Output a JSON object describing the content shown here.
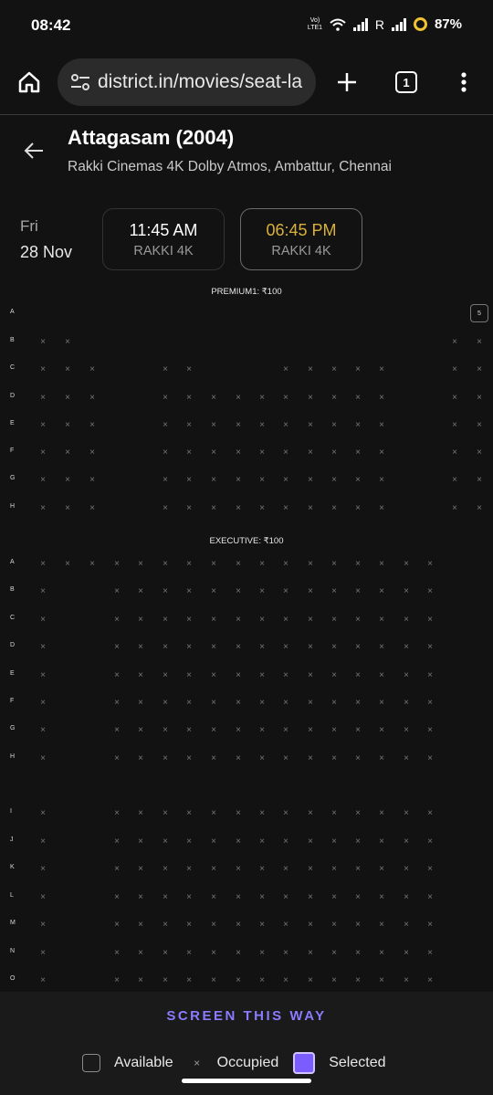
{
  "status_bar": {
    "time": "08:42",
    "volte": "Vo) LTE1",
    "roaming": "R",
    "battery": "87%"
  },
  "browser": {
    "url": "district.in/movies/seat-la",
    "tab_count": "1"
  },
  "movie": {
    "title": "Attagasam (2004)",
    "venue": "Rakki Cinemas 4K Dolby Atmos, Ambattur, Chennai"
  },
  "date": {
    "day": "Fri",
    "date": "28 Nov"
  },
  "showtimes": [
    {
      "time": "11:45 AM",
      "screen": "RAKKI 4K",
      "selected": false
    },
    {
      "time": "06:45 PM",
      "screen": "RAKKI 4K",
      "selected": true
    }
  ],
  "sections": [
    {
      "label": "PREMIUM1: ₹100",
      "rows": [
        "A",
        "B",
        "C",
        "D",
        "E",
        "F",
        "G",
        "H"
      ]
    },
    {
      "label": "EXECUTIVE: ₹100",
      "rows": [
        "A",
        "B",
        "C",
        "D",
        "E",
        "F",
        "G",
        "H",
        "I",
        "J",
        "K",
        "L",
        "M",
        "N",
        "O"
      ]
    }
  ],
  "available_seat_label": "5",
  "screen_label": "SCREEN THIS WAY",
  "legend": {
    "available": "Available",
    "occupied": "Occupied",
    "selected": "Selected"
  },
  "colors": {
    "background": "#121212",
    "accent": "#7b5cff",
    "selected_time": "#d9b13b",
    "screen_text": "#8a7bff"
  }
}
